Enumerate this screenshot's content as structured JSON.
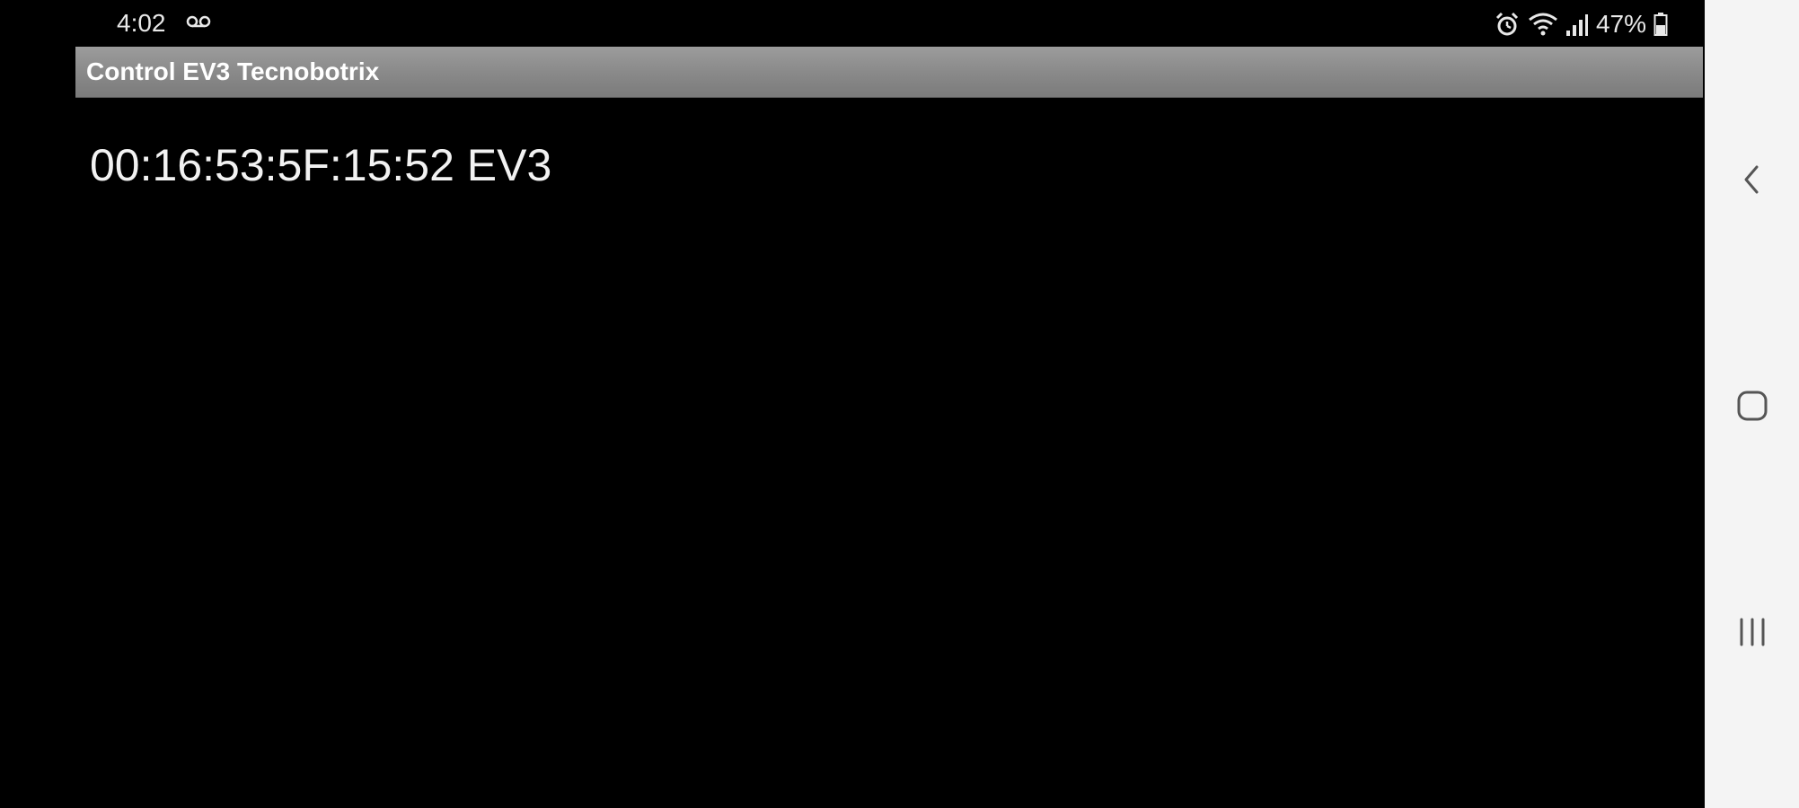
{
  "status_bar": {
    "time": "4:02",
    "battery_percent": "47%",
    "icons": [
      "voicemail-icon",
      "alarm-icon",
      "wifi-icon",
      "signal-icon",
      "battery-icon"
    ]
  },
  "app": {
    "title": "Control EV3 Tecnobotrix"
  },
  "devices": [
    {
      "label": "00:16:53:5F:15:52 EV3"
    }
  ],
  "nav_bar": {
    "buttons": [
      "back-icon",
      "home-icon",
      "recent-apps-icon"
    ]
  },
  "colors": {
    "background": "#000000",
    "title_bar": "#8a8a8a",
    "text": "#f2f2f2",
    "nav_bar": "#f4f4f4"
  }
}
